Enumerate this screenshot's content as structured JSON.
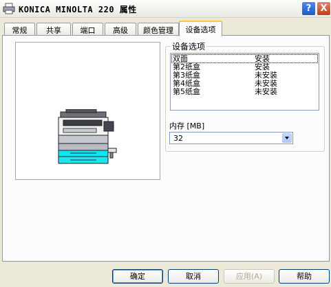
{
  "window": {
    "title": "KONICA MINOLTA 220 属性",
    "help_label": "?",
    "close_label": "X"
  },
  "tabs": [
    {
      "label": "常规"
    },
    {
      "label": "共享"
    },
    {
      "label": "端口"
    },
    {
      "label": "高级"
    },
    {
      "label": "颜色管理"
    },
    {
      "label": "设备选项"
    }
  ],
  "active_tab": "设备选项",
  "options": {
    "legend": "设备选项",
    "rows": [
      {
        "name": "双面",
        "status": "安装"
      },
      {
        "name": "第2纸盒",
        "status": "安装"
      },
      {
        "name": "第3纸盒",
        "status": "未安装"
      },
      {
        "name": "第4纸盒",
        "status": "未安装"
      },
      {
        "name": "第5纸盒",
        "status": "未安装"
      }
    ],
    "memory_label": "内存 [MB]",
    "memory_value": "32"
  },
  "buttons": {
    "ok": "确定",
    "cancel": "取消",
    "apply": "应用(A)",
    "help": "帮助"
  },
  "colors": {
    "active_tab_accent": "#ffc83c",
    "titlebar_close": "#c13d1c",
    "titlebar_help": "#2158c9"
  }
}
